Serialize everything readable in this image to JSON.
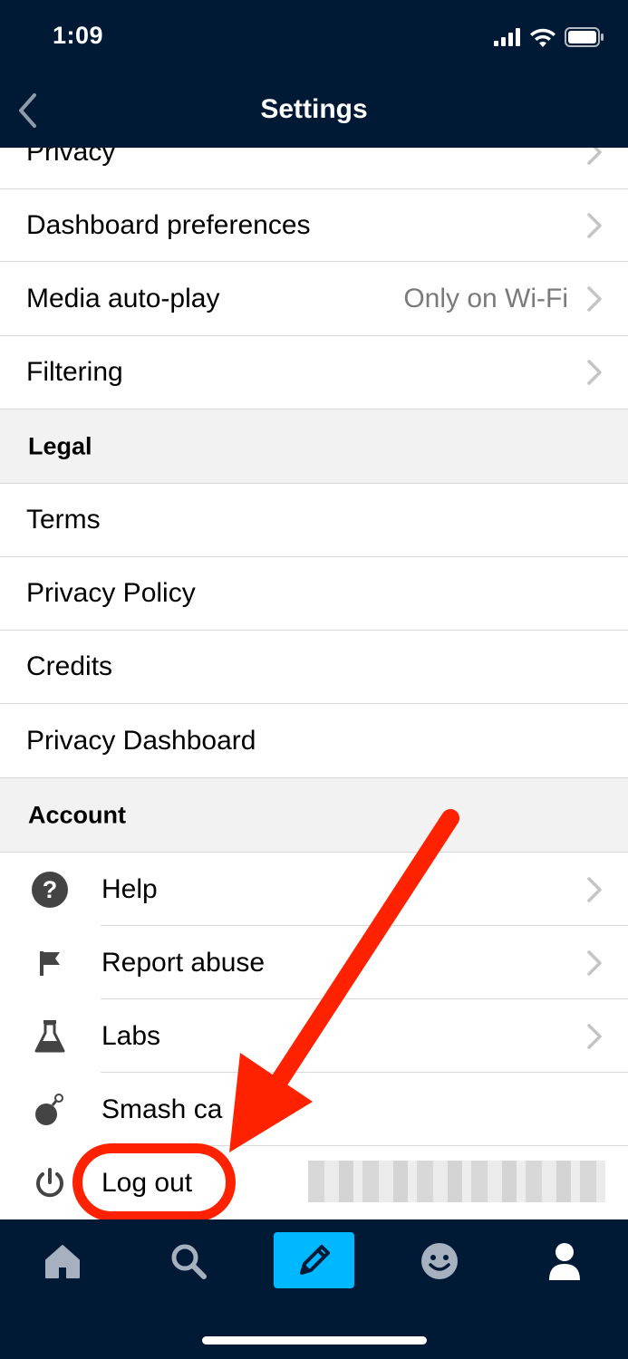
{
  "status_bar": {
    "time": "1:09"
  },
  "header": {
    "title": "Settings",
    "back_icon": "chevron-left-icon"
  },
  "settings_rows": [
    {
      "label": "Privacy",
      "value": ""
    },
    {
      "label": "Dashboard preferences",
      "value": ""
    },
    {
      "label": "Media auto-play",
      "value": "Only on Wi-Fi"
    },
    {
      "label": "Filtering",
      "value": ""
    }
  ],
  "legal": {
    "header": "Legal",
    "items": [
      "Terms",
      "Privacy Policy",
      "Credits",
      "Privacy Dashboard"
    ]
  },
  "account": {
    "header": "Account",
    "items": [
      {
        "label": "Help",
        "icon": "help-circle-icon"
      },
      {
        "label": "Report abuse",
        "icon": "flag-icon"
      },
      {
        "label": "Labs",
        "icon": "flask-icon"
      },
      {
        "label": "Smash ca",
        "icon": "bomb-icon"
      },
      {
        "label": "Log out",
        "icon": "power-icon"
      }
    ]
  },
  "tabs": [
    {
      "name": "home",
      "icon": "home-icon"
    },
    {
      "name": "search",
      "icon": "search-icon"
    },
    {
      "name": "compose",
      "icon": "pencil-icon"
    },
    {
      "name": "activity",
      "icon": "smiley-icon"
    },
    {
      "name": "account",
      "icon": "person-icon"
    }
  ],
  "colors": {
    "header_bg": "#001935",
    "compose_accent": "#00b8ff",
    "annotation_red": "#ff2200",
    "section_bg": "#f2f2f2"
  }
}
